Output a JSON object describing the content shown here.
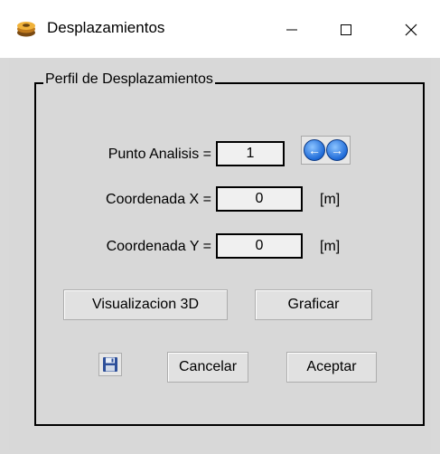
{
  "window": {
    "title": "Desplazamientos",
    "icons": {
      "app": "disk-stack-icon",
      "minimize": "minimize-icon",
      "maximize": "maximize-icon",
      "close": "close-icon"
    }
  },
  "group": {
    "title": "Perfil de Desplazamientos"
  },
  "fields": {
    "punto_label": "Punto Analisis =",
    "punto_value": "1",
    "coord_x_label": "Coordenada X =",
    "coord_x_value": "0",
    "coord_x_unit": "[m]",
    "coord_y_label": "Coordenada Y =",
    "coord_y_value": "0",
    "coord_y_unit": "[m]"
  },
  "nav": {
    "prev_icon": "arrow-left-icon",
    "next_icon": "arrow-right-icon"
  },
  "buttons": {
    "visualizacion": "Visualizacion 3D",
    "graficar": "Graficar",
    "save_icon": "floppy-disk-icon",
    "cancelar": "Cancelar",
    "aceptar": "Aceptar"
  },
  "colors": {
    "client_bg": "#d8d8d8",
    "nav_blue": "#1e6ad8"
  }
}
